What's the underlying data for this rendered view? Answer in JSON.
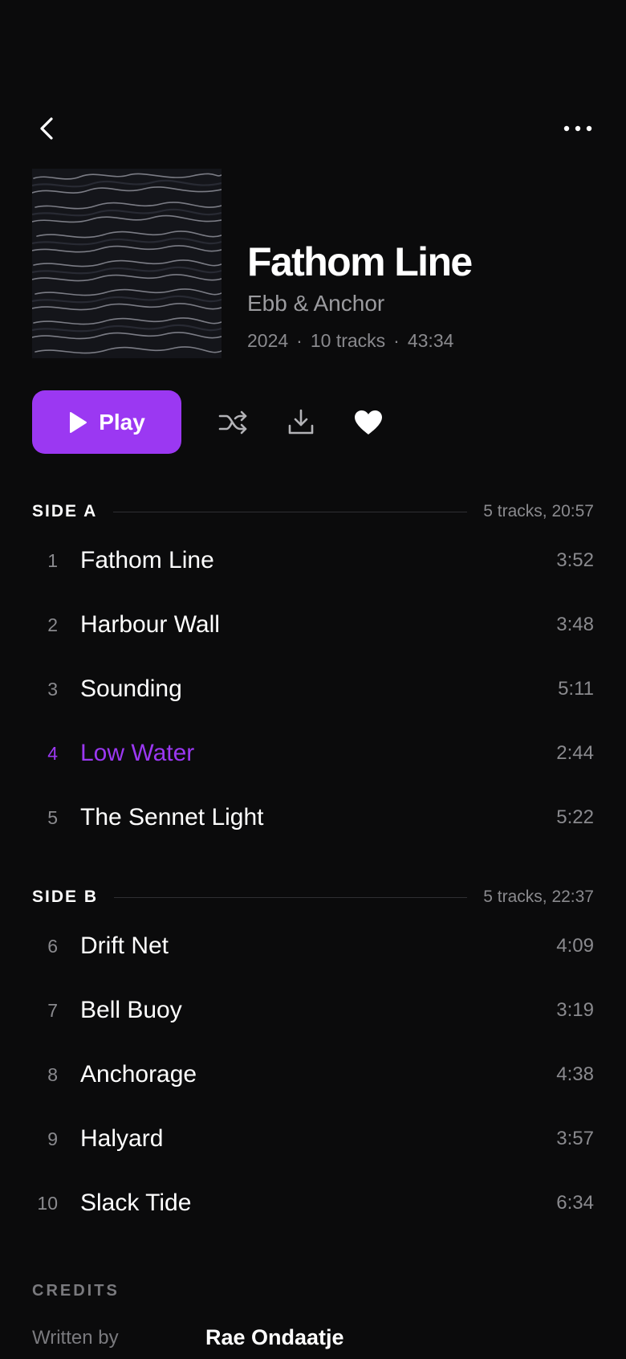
{
  "album": {
    "title": "Fathom Line",
    "artist": "Ebb & Anchor",
    "year": "2024",
    "track_count": "10 tracks",
    "total_duration": "43:34",
    "separator": "·"
  },
  "actions": {
    "play_label": "Play",
    "accent_color": "#9b38f2"
  },
  "icons": {
    "back": "chevron-left-icon",
    "more": "more-horizontal-icon",
    "play": "play-icon",
    "shuffle": "shuffle-icon",
    "download": "download-icon",
    "like": "heart-icon"
  },
  "sides": [
    {
      "label": "SIDE A",
      "summary": "5 tracks, 20:57",
      "tracks": [
        {
          "num": "1",
          "title": "Fathom Line",
          "duration": "3:52"
        },
        {
          "num": "2",
          "title": "Harbour Wall",
          "duration": "3:48"
        },
        {
          "num": "3",
          "title": "Sounding",
          "duration": "5:11"
        },
        {
          "num": "4",
          "title": "Low Water",
          "duration": "2:44"
        },
        {
          "num": "5",
          "title": "The Sennet Light",
          "duration": "5:22"
        }
      ]
    },
    {
      "label": "SIDE B",
      "summary": "5 tracks, 22:37",
      "tracks": [
        {
          "num": "6",
          "title": "Drift Net",
          "duration": "4:09"
        },
        {
          "num": "7",
          "title": "Bell Buoy",
          "duration": "3:19"
        },
        {
          "num": "8",
          "title": "Anchorage",
          "duration": "4:38"
        },
        {
          "num": "9",
          "title": "Halyard",
          "duration": "3:57"
        },
        {
          "num": "10",
          "title": "Slack Tide",
          "duration": "6:34"
        }
      ]
    }
  ],
  "credits": {
    "label": "CREDITS",
    "rows": [
      {
        "key": "Written by",
        "value": "Rae Ondaatje"
      }
    ]
  }
}
